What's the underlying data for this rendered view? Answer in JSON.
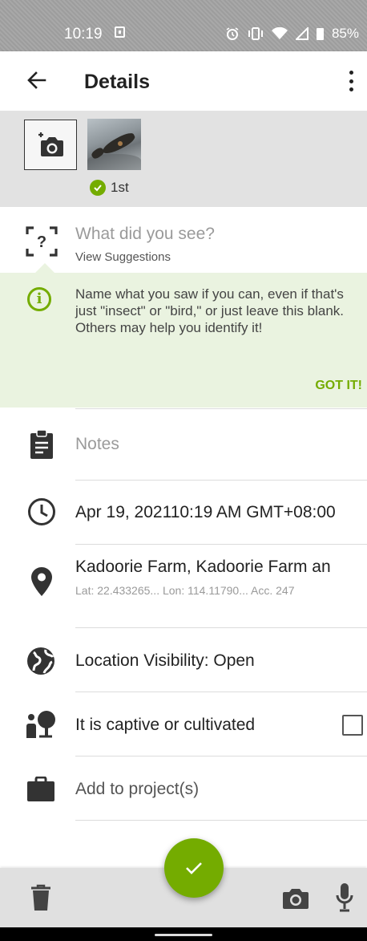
{
  "status_bar": {
    "time": "10:19",
    "battery": "85%",
    "icons": [
      "download-icon",
      "alarm-icon",
      "vibrate-icon",
      "wifi-icon",
      "signal-icon",
      "battery-icon"
    ]
  },
  "app_bar": {
    "title": "Details"
  },
  "photos": {
    "badge_label": "1st"
  },
  "identification": {
    "placeholder": "What did you see?",
    "suggestions_link": "View Suggestions"
  },
  "tip": {
    "text": "Name what you saw if you can, even if that's just \"insect\" or \"bird,\" or just leave this blank. Others may help you identify it!",
    "dismiss_label": "GOT IT!"
  },
  "notes": {
    "placeholder": "Notes"
  },
  "date": {
    "value": "Apr 19, 202110:19 AM GMT+08:00"
  },
  "location": {
    "name": "Kadoorie Farm, Kadoorie Farm an",
    "details": "Lat: 22.433265...  Lon: 114.11790...  Acc. 247"
  },
  "visibility": {
    "label": "Location Visibility: Open"
  },
  "captive": {
    "label": "It is captive or cultivated",
    "checked": false
  },
  "projects": {
    "placeholder": "Add to project(s)"
  },
  "colors": {
    "accent": "#74ac00",
    "tip_background": "#eaf3e0",
    "photo_strip": "#e2e2e2",
    "bottom_bar": "#e0e0e0"
  }
}
